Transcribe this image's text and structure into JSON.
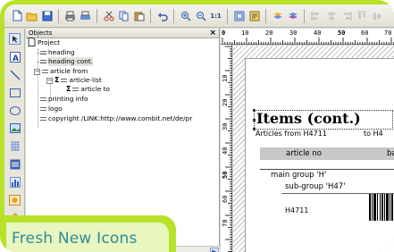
{
  "toolbar": {
    "buttons": [
      {
        "icon": "new-document-icon",
        "enabled": true
      },
      {
        "icon": "open-folder-icon",
        "enabled": true
      },
      {
        "icon": "save-icon",
        "enabled": true
      },
      {
        "icon": "print-icon",
        "enabled": true
      },
      {
        "icon": "print-preview-icon",
        "enabled": true
      },
      {
        "icon": "cut-icon",
        "enabled": true
      },
      {
        "icon": "copy-icon",
        "enabled": true
      },
      {
        "icon": "paste-icon",
        "enabled": true
      },
      {
        "icon": "undo-icon",
        "enabled": true
      },
      {
        "icon": "zoom-in-icon",
        "enabled": true
      },
      {
        "icon": "zoom-out-icon",
        "enabled": true
      },
      {
        "icon": "zoom-1-1-icon",
        "label": "1:1",
        "enabled": true
      },
      {
        "icon": "fit-page-icon",
        "enabled": true
      },
      {
        "icon": "properties-icon",
        "enabled": true
      },
      {
        "icon": "layers-icon",
        "enabled": true
      },
      {
        "icon": "layers2-icon",
        "enabled": true
      },
      {
        "icon": "align-left-icon",
        "enabled": false
      },
      {
        "icon": "align-center-icon",
        "enabled": false
      },
      {
        "icon": "align-right-icon",
        "enabled": false
      },
      {
        "icon": "align-top-icon",
        "enabled": false
      },
      {
        "icon": "align-middle-icon",
        "enabled": false
      }
    ]
  },
  "tools": [
    "select-icon",
    "text-icon",
    "line-icon",
    "rectangle-icon",
    "ellipse-icon",
    "image-icon",
    "table-icon",
    "barcode-icon",
    "chart-icon",
    "gauge-icon",
    "person-icon"
  ],
  "objects_panel": {
    "title": "Objects",
    "close": "×",
    "tree": [
      {
        "label": "Project",
        "level": 0,
        "kind": "doc"
      },
      {
        "label": "heading",
        "level": 1,
        "kind": "field"
      },
      {
        "label": "heading cont.",
        "level": 1,
        "kind": "field",
        "selected": true
      },
      {
        "label": "article from",
        "level": 1,
        "kind": "field",
        "expander": "−"
      },
      {
        "label": "article-list",
        "level": 2,
        "kind": "sigma",
        "expander": "−"
      },
      {
        "label": "article to",
        "level": 3,
        "kind": "sigma"
      },
      {
        "label": "printing info",
        "level": 1,
        "kind": "field"
      },
      {
        "label": "logo",
        "level": 1,
        "kind": "field"
      },
      {
        "label": "copyright /LINK:http://www.combit.net/de/pr",
        "level": 1,
        "kind": "field"
      }
    ]
  },
  "badge": {
    "text": "Fresh New Icons"
  },
  "ruler": {
    "h_labels": [
      "0",
      "10",
      "20",
      "30",
      "40",
      "50",
      "60",
      "70"
    ],
    "v_labels": [
      "10",
      "20",
      "30",
      "40",
      "50",
      "60",
      "70"
    ]
  },
  "canvas": {
    "title": "Items (cont.)",
    "articles_from": "Articles from H4711",
    "to": "to H4",
    "col_article": "article no",
    "col_ba": "ba",
    "main_group": "main group 'H'",
    "sub_group": "sub-group 'H47'",
    "item": "H4711"
  },
  "colors": {
    "accent": "#b8e22a",
    "badge_text": "#2f8b96",
    "badge_bg": "#e8f6c0"
  }
}
